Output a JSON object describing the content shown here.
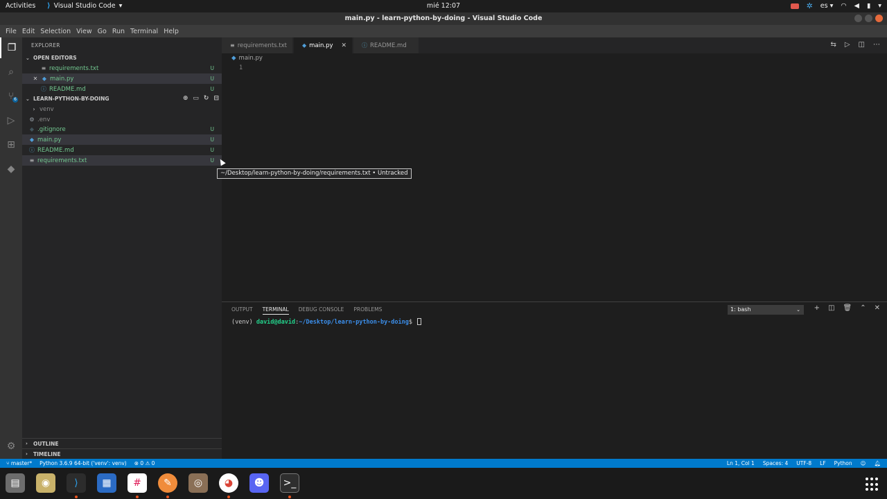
{
  "gnome": {
    "activities": "Activities",
    "app_name": "Visual Studio Code",
    "clock": "mié 12:07",
    "lang": "es ▾"
  },
  "window": {
    "title": "main.py - learn-python-by-doing - Visual Studio Code"
  },
  "menu": [
    "File",
    "Edit",
    "Selection",
    "View",
    "Go",
    "Run",
    "Terminal",
    "Help"
  ],
  "sidebar": {
    "title": "EXPLORER",
    "open_editors": {
      "label": "OPEN EDITORS",
      "items": [
        {
          "name": "requirements.txt",
          "status": "U",
          "icon": "text-file-icon"
        },
        {
          "name": "main.py",
          "status": "U",
          "icon": "python-file-icon"
        },
        {
          "name": "README.md",
          "status": "U",
          "icon": "info-file-icon"
        }
      ]
    },
    "project": {
      "label": "LEARN-PYTHON-BY-DOING",
      "items": [
        {
          "name": "venv",
          "status": ""
        },
        {
          "name": ".env",
          "status": ""
        },
        {
          "name": ".gitignore",
          "status": "U"
        },
        {
          "name": "main.py",
          "status": "U"
        },
        {
          "name": "README.md",
          "status": "U"
        },
        {
          "name": "requirements.txt",
          "status": "U"
        }
      ]
    },
    "outline": "OUTLINE",
    "timeline": "TIMELINE"
  },
  "tabs": [
    {
      "label": "requirements.txt",
      "active": false
    },
    {
      "label": "main.py",
      "active": true
    },
    {
      "label": "README.md",
      "active": false
    }
  ],
  "editor": {
    "breadcrumb": "main.py",
    "line_number": "1",
    "tooltip": "~/Desktop/learn-python-by-doing/requirements.txt • Untracked"
  },
  "panel": {
    "tabs": [
      "OUTPUT",
      "TERMINAL",
      "DEBUG CONSOLE",
      "PROBLEMS"
    ],
    "active_tab": "TERMINAL",
    "terminal_select": "1: bash",
    "prompt_env": "(venv) ",
    "prompt_user": "david@david",
    "prompt_colon": ":",
    "prompt_path": "~/Desktop/learn-python-by-doing",
    "prompt_symbol": "$ "
  },
  "statusbar": {
    "branch": "master*",
    "interpreter": "Python 3.6.9 64-bit ('venv': venv)",
    "problems": "⊗ 0 ⚠ 0",
    "position": "Ln 1, Col 1",
    "spaces": "Spaces: 4",
    "encoding": "UTF-8",
    "eol": "LF",
    "language": "Python"
  },
  "colors": {
    "accent": "#007acc",
    "untracked": "#73c991",
    "sidebar_bg": "#252526",
    "editor_bg": "#1e1e1e"
  }
}
